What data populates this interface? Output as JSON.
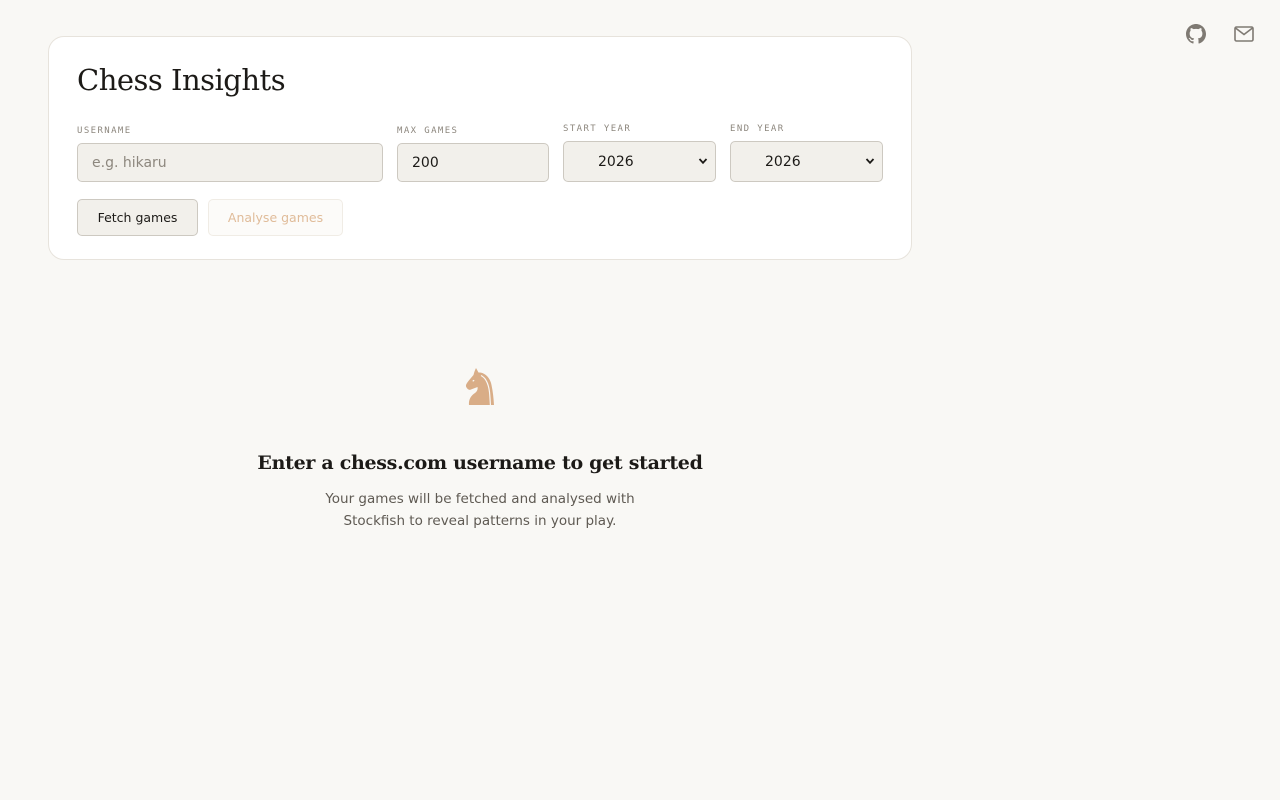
{
  "header": {
    "icons": [
      "github-icon",
      "mail-icon"
    ]
  },
  "form": {
    "title": "Chess Insights",
    "username": {
      "label": "USERNAME",
      "placeholder": "e.g. hikaru",
      "value": ""
    },
    "max_games": {
      "label": "MAX GAMES",
      "value": "200"
    },
    "start_year": {
      "label": "START YEAR",
      "selected": "2026"
    },
    "end_year": {
      "label": "END YEAR",
      "selected": "2026"
    },
    "fetch_label": "Fetch games",
    "analyse_label": "Analyse games"
  },
  "empty_state": {
    "icon": "knight-icon",
    "title": "Enter a chess.com username to get started",
    "text": "Your games will be fetched and analysed with Stockfish to reveal patterns in your play."
  },
  "colors": {
    "background": "#f9f8f5",
    "accent": "#d9ad87",
    "text": "#1c1a17",
    "muted": "#8d877e"
  }
}
